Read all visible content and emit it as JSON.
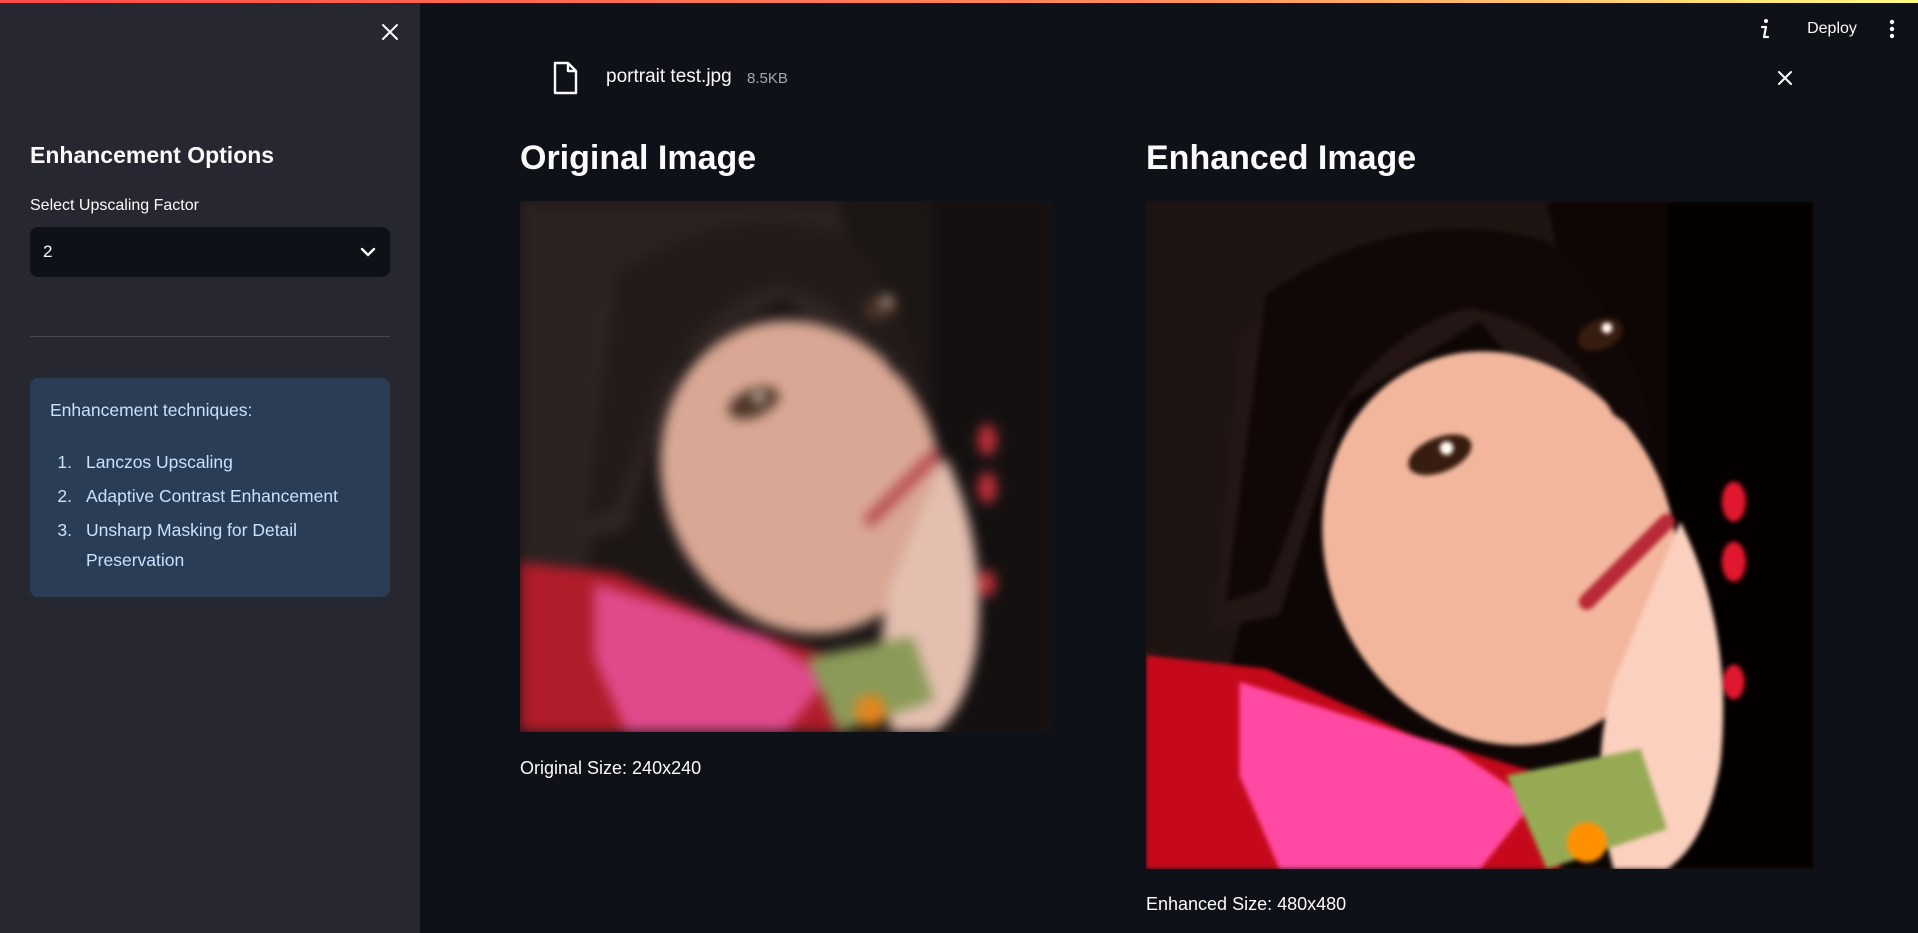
{
  "sidebar": {
    "title": "Enhancement Options",
    "select_label": "Select Upscaling Factor",
    "select_value": "2",
    "info_heading": "Enhancement techniques:",
    "techniques": [
      {
        "num": "1.",
        "text": "Lanczos Upscaling"
      },
      {
        "num": "2.",
        "text": "Adaptive Contrast Enhancement"
      },
      {
        "num": "3.",
        "text": "Unsharp Masking for Detail Preservation"
      }
    ]
  },
  "header": {
    "deploy_label": "Deploy"
  },
  "file": {
    "name": "portrait test.jpg",
    "size": "8.5KB"
  },
  "original": {
    "title": "Original Image",
    "caption": "Original Size: 240x240"
  },
  "enhanced": {
    "title": "Enhanced Image",
    "caption": "Enhanced Size: 480x480"
  },
  "icons": {
    "sidebar_close": "close-icon",
    "select_arrow": "chevron-down-icon",
    "info": "info-icon",
    "menu": "kebab-menu-icon",
    "file": "file-icon",
    "file_remove": "close-icon"
  },
  "colors": {
    "background": "#0e1117",
    "sidebar": "#262730",
    "info_box": "#2a3d55",
    "info_text": "#c7e1ff"
  }
}
